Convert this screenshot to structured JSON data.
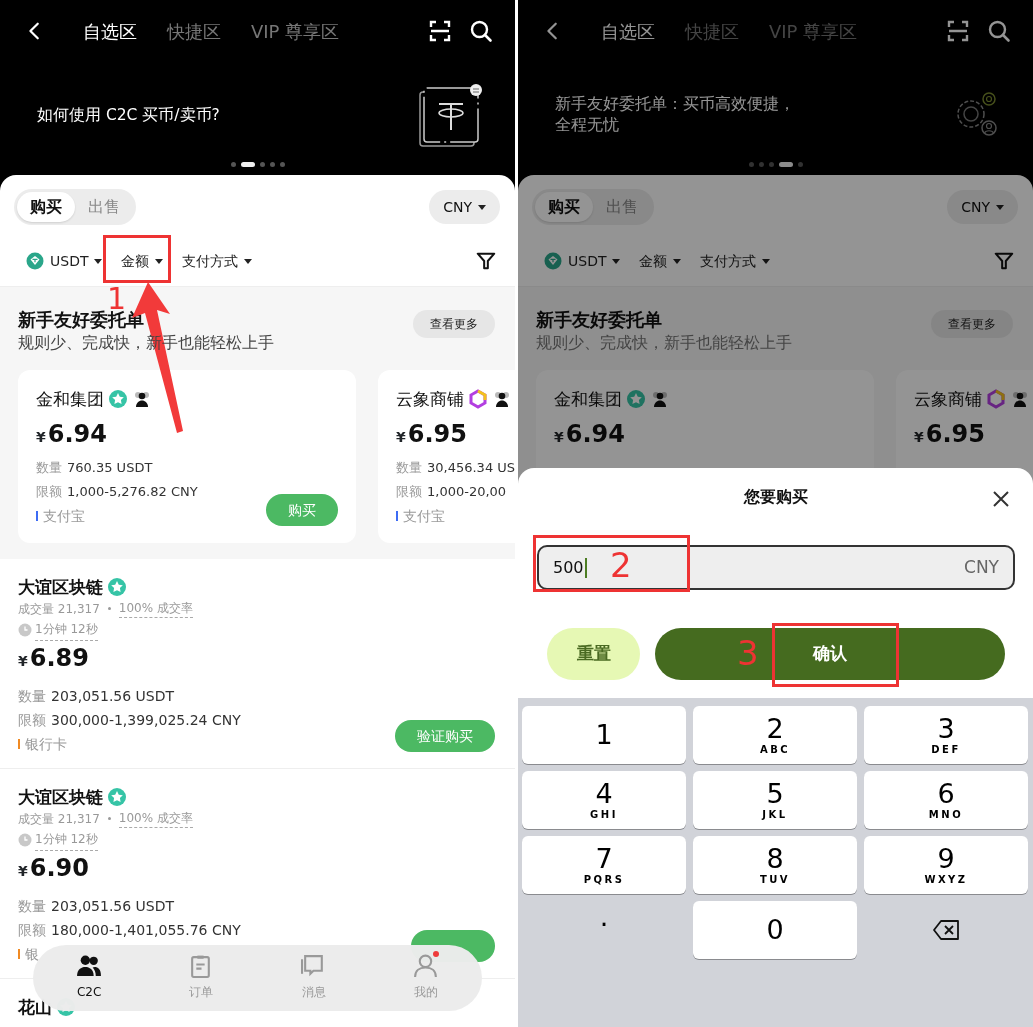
{
  "screens": [
    {
      "tabs": [
        {
          "label": "自选区",
          "selected": true
        },
        {
          "label": "快捷区",
          "selected": false
        },
        {
          "label": "VIP 尊享区",
          "selected": false
        }
      ],
      "banner": {
        "text": "如何使用 C2C 买币/卖币?",
        "kind": "coin-card"
      },
      "pager": [
        {
          "selected": false
        },
        {
          "selected": true
        },
        {
          "selected": false
        },
        {
          "selected": false
        },
        {
          "selected": false
        }
      ],
      "trade_toggle": [
        {
          "label": "购买",
          "selected": true
        },
        {
          "label": "出售",
          "selected": false
        }
      ],
      "currency": "CNY",
      "filters": [
        {
          "label": "USDT",
          "kind": "coin"
        },
        {
          "label": "金额",
          "kind": "plain"
        },
        {
          "label": "支付方式",
          "kind": "plain"
        }
      ],
      "featured": {
        "title": "新手友好委托单",
        "subtitle": "规则少、完成快，新手也能轻松上手",
        "more": "查看更多",
        "cards": [
          {
            "name": "金和集团",
            "badge": {
              "kind": "star"
            },
            "group_icon": true,
            "currency_symbol": "¥",
            "price": "6.94",
            "quantity_label": "数量",
            "quantity": "760.35 USDT",
            "limit_label": "限额",
            "limit": "1,000-5,276.82 CNY",
            "payment": "支付宝",
            "color": "#3d6cf4",
            "button": "购买"
          },
          {
            "name": "云象商铺",
            "badge": {
              "kind": "hexagon"
            },
            "group_icon": true,
            "currency_symbol": "¥",
            "price": "6.95",
            "quantity_label": "数量",
            "quantity": "30,456.34 US",
            "limit_label": "限额",
            "limit": "1,000-20,00",
            "payment": "支付宝",
            "color": "#3d6cf4"
          }
        ]
      },
      "listings": [
        {
          "name": "大谊区块链",
          "badge": {
            "kind": "star"
          },
          "volume": "成交量 21,317",
          "completion": "100% 成交率",
          "time": "1分钟 12秒",
          "currency_symbol": "¥",
          "price": "6.89",
          "quantity_label": "数量",
          "quantity": "203,051.56 USDT",
          "limit_label": "限额",
          "limit": "300,000-1,399,025.24 CNY",
          "payment": "银行卡",
          "color": "#f08a24",
          "button": "验证购买"
        },
        {
          "name": "大谊区块链",
          "badge": {
            "kind": "star"
          },
          "volume": "成交量 21,317",
          "completion": "100% 成交率",
          "time": "1分钟 12秒",
          "currency_symbol": "¥",
          "price": "6.90",
          "quantity_label": "数量",
          "quantity": "203,051.56 USDT",
          "limit_label": "限额",
          "limit": "180,000-1,401,055.76 CNY",
          "payment": "银",
          "color": "#f08a24"
        },
        {
          "name": "花山",
          "badge": {
            "kind": "star"
          }
        }
      ],
      "nav": [
        {
          "label": "C2C",
          "kind": "people",
          "selected": true
        },
        {
          "label": "订单",
          "kind": "clipboard",
          "selected": false
        },
        {
          "label": "消息",
          "kind": "chat",
          "selected": false
        },
        {
          "label": "我的",
          "kind": "person",
          "selected": false,
          "notification": true
        }
      ],
      "annotations": [
        {
          "label": "1",
          "arrow": true
        }
      ]
    },
    {
      "tabs": [
        {
          "label": "自选区",
          "selected": true
        },
        {
          "label": "快捷区",
          "selected": false
        },
        {
          "label": "VIP 尊享区",
          "selected": false
        }
      ],
      "banner": {
        "text": "新手友好委托单：买币高效便捷，全程无忧",
        "kind": "gears"
      },
      "pager": [
        {
          "selected": false
        },
        {
          "selected": false
        },
        {
          "selected": false
        },
        {
          "selected": true
        },
        {
          "selected": false
        }
      ],
      "trade_toggle": [
        {
          "label": "购买",
          "selected": true
        },
        {
          "label": "出售",
          "selected": false
        }
      ],
      "currency": "CNY",
      "filters": [
        {
          "label": "USDT",
          "kind": "coin"
        },
        {
          "label": "金额",
          "kind": "plain"
        },
        {
          "label": "支付方式",
          "kind": "plain"
        }
      ],
      "featured": {
        "title": "新手友好委托单",
        "subtitle": "规则少、完成快，新手也能轻松上手",
        "more": "查看更多",
        "cards": [
          {
            "name": "金和集团",
            "badge": {
              "kind": "star"
            },
            "group_icon": true,
            "currency_symbol": "¥",
            "price": "6.94"
          },
          {
            "name": "云象商铺",
            "badge": {
              "kind": "hexagon"
            },
            "group_icon": true,
            "currency_symbol": "¥",
            "price": "6.95"
          }
        ]
      },
      "dimmed": true,
      "modal": {
        "title": "您要购买",
        "amount": "500",
        "unit": "CNY",
        "reset": "重置",
        "confirm": "确认"
      },
      "keypad": [
        {
          "kind": "key",
          "digit": "1"
        },
        {
          "kind": "key",
          "digit": "2",
          "letters": "ABC"
        },
        {
          "kind": "key",
          "digit": "3",
          "letters": "DEF"
        },
        {
          "kind": "key",
          "digit": "4",
          "letters": "GHI"
        },
        {
          "kind": "key",
          "digit": "5",
          "letters": "JKL"
        },
        {
          "kind": "key",
          "digit": "6",
          "letters": "MNO"
        },
        {
          "kind": "key",
          "digit": "7",
          "letters": "PQRS"
        },
        {
          "kind": "key",
          "digit": "8",
          "letters": "TUV"
        },
        {
          "kind": "key",
          "digit": "9",
          "letters": "WXYZ"
        },
        {
          "kind": "plain",
          "digit": "."
        },
        {
          "kind": "key",
          "digit": "0"
        },
        {
          "kind": "backspace"
        }
      ],
      "annotations": [
        {
          "label": "2",
          "arrow": false
        },
        {
          "label": "3",
          "arrow": false
        }
      ]
    }
  ]
}
